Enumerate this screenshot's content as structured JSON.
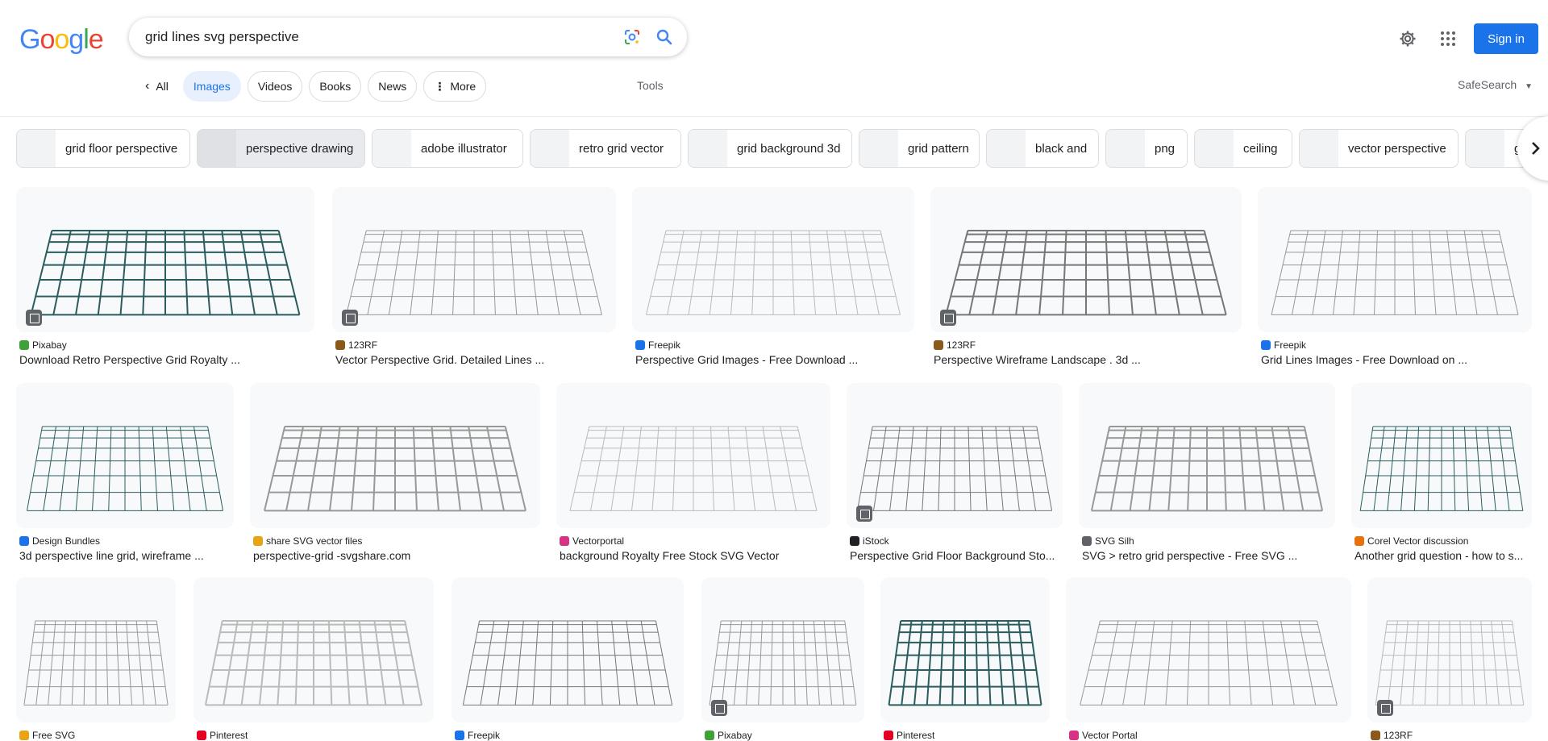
{
  "header": {
    "logo": "Google",
    "search_query": "grid lines svg perspective",
    "signin_label": "Sign in"
  },
  "tabs": [
    {
      "label": "All"
    },
    {
      "label": "Images"
    },
    {
      "label": "Videos"
    },
    {
      "label": "Books"
    },
    {
      "label": "News"
    },
    {
      "label": "More"
    }
  ],
  "tools_label": "Tools",
  "safesearch_label": "SafeSearch",
  "chips": [
    "grid floor perspective",
    "perspective drawing",
    "adobe illustrator",
    "retro grid vector",
    "grid background 3d",
    "grid pattern",
    "black and",
    "png",
    "ceiling",
    "vector perspective",
    "gri"
  ],
  "results": [
    {
      "source": "Pixabay",
      "title": "Download Retro Perspective Grid Royalty ...",
      "fav": "#3ea13a"
    },
    {
      "source": "123RF",
      "title": "Vector Perspective Grid. Detailed Lines ...",
      "fav": "#8a5a1a"
    },
    {
      "source": "Freepik",
      "title": "Perspective Grid Images - Free Download ...",
      "fav": "#1a73e8"
    },
    {
      "source": "123RF",
      "title": "Perspective Wireframe Landscape . 3d ...",
      "fav": "#8a5a1a"
    },
    {
      "source": "Freepik",
      "title": "Grid Lines Images - Free Download on ...",
      "fav": "#1a73e8"
    },
    {
      "source": "Design Bundles",
      "title": "3d perspective line grid, wireframe ...",
      "fav": "#1a73e8"
    },
    {
      "source": "share SVG vector files",
      "title": "perspective-grid -svgshare.com",
      "fav": "#e8a317"
    },
    {
      "source": "Vectorportal",
      "title": "background Royalty Free Stock SVG Vector",
      "fav": "#d63384"
    },
    {
      "source": "iStock",
      "title": "Perspective Grid Floor Background Sto...",
      "fav": "#202124"
    },
    {
      "source": "SVG Silh",
      "title": "SVG > retro grid perspective - Free SVG ...",
      "fav": "#5f6368"
    },
    {
      "source": "Corel Vector discussion",
      "title": "Another grid question - how to s...",
      "fav": "#e8710a"
    },
    {
      "source": "Free SVG",
      "title": "",
      "fav": "#e8a317"
    },
    {
      "source": "Pinterest",
      "title": "",
      "fav": "#e60023"
    },
    {
      "source": "Freepik",
      "title": "",
      "fav": "#1a73e8"
    },
    {
      "source": "Pixabay",
      "title": "",
      "fav": "#3ea13a"
    },
    {
      "source": "Pinterest",
      "title": "",
      "fav": "#e60023"
    },
    {
      "source": "Vector Portal",
      "title": "",
      "fav": "#d63384"
    },
    {
      "source": "123RF",
      "title": "",
      "fav": "#8a5a1a"
    }
  ]
}
